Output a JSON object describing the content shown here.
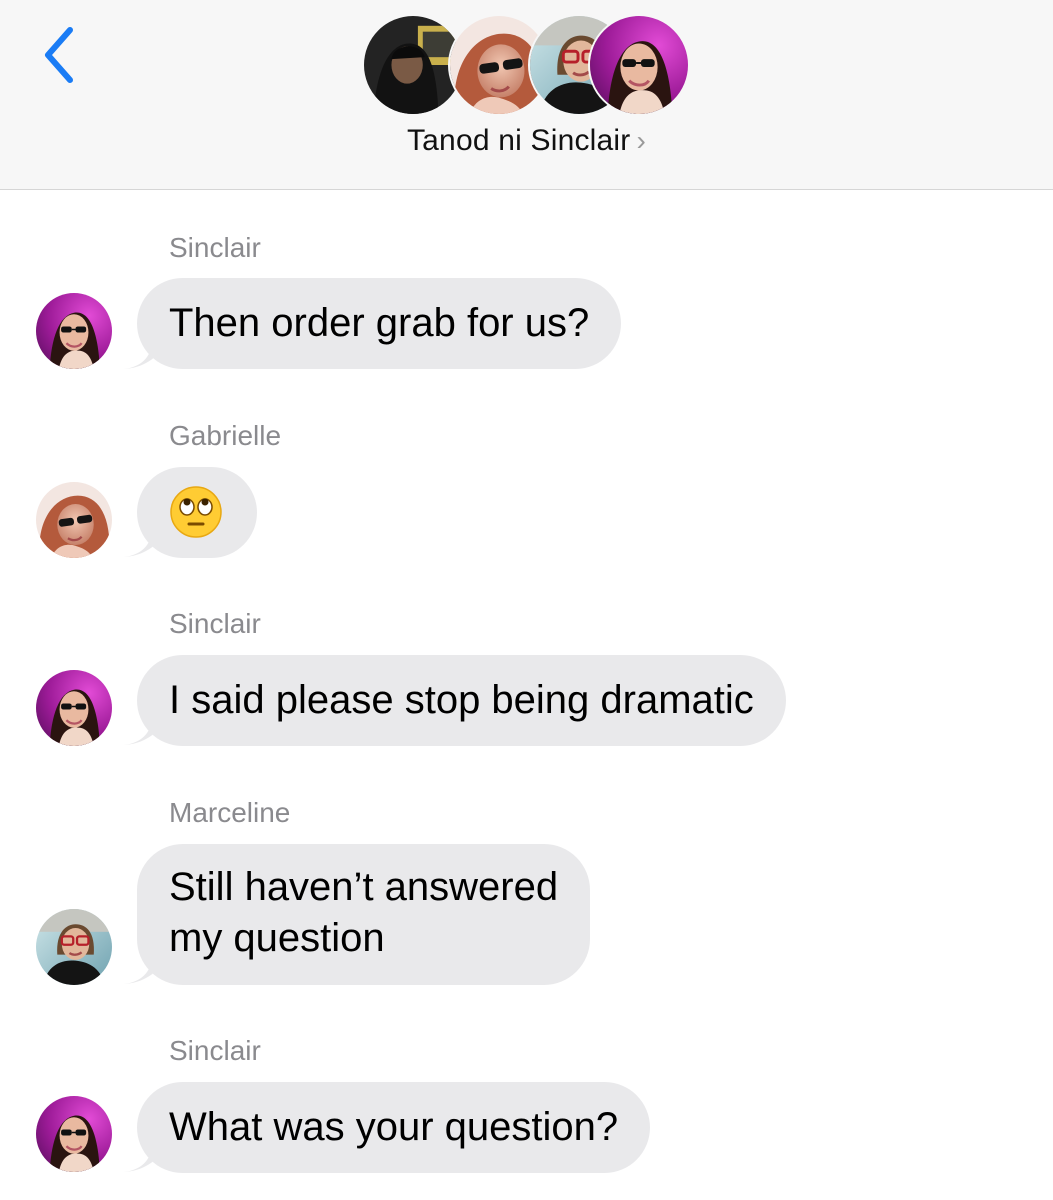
{
  "header": {
    "back_icon": "chevron-left-icon",
    "group_name": "Tanod ni Sinclair",
    "chevron": "›",
    "accent_color": "#1a7cf5"
  },
  "messages": [
    {
      "sender": "Sinclair",
      "text": "Then order grab for us?",
      "avatar": "sinclair"
    },
    {
      "sender": "Gabrielle",
      "text": "",
      "emoji": "face-with-rolling-eyes",
      "avatar": "gabrielle"
    },
    {
      "sender": "Sinclair",
      "text": "I said please stop being dramatic",
      "avatar": "sinclair"
    },
    {
      "sender": "Marceline",
      "text": "Still haven’t answered my question",
      "text_lines": [
        "Still haven’t answered",
        "my question"
      ],
      "avatar": "marceline"
    },
    {
      "sender": "Sinclair",
      "text": "What was your question?",
      "avatar": "sinclair"
    }
  ],
  "colors": {
    "bubble": "#e9e9eb",
    "sender_label": "#8a8a8e",
    "header_bg": "#f7f7f7"
  }
}
